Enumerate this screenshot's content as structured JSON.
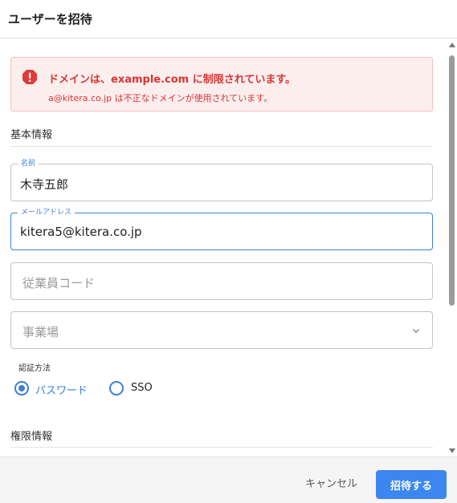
{
  "dialog": {
    "title": "ユーザーを招待"
  },
  "alert": {
    "title": "ドメインは、example.com に制限されています。",
    "detail": "a@kitera.co.jp は不正なドメインが使用されています。",
    "icon": "error-icon",
    "color": "#d93636"
  },
  "basic_info": {
    "heading": "基本情報",
    "name": {
      "label": "名前",
      "value": "木寺五郎"
    },
    "email": {
      "label": "メールアドレス",
      "value": "kitera5@kitera.co.jp"
    },
    "employee_code": {
      "placeholder": "従業員コード"
    },
    "office": {
      "placeholder": "事業場",
      "icon": "chevron-down-icon"
    },
    "auth": {
      "label": "認証方法",
      "options": [
        {
          "label": "パスワード",
          "selected": true
        },
        {
          "label": "SSO",
          "selected": false
        }
      ]
    }
  },
  "permission_info": {
    "heading": "権限情報"
  },
  "footer": {
    "cancel_label": "キャンセル",
    "invite_label": "招待する"
  },
  "colors": {
    "accent": "#3c86f0",
    "error": "#d93636",
    "error_bg": "#fdeeee"
  }
}
